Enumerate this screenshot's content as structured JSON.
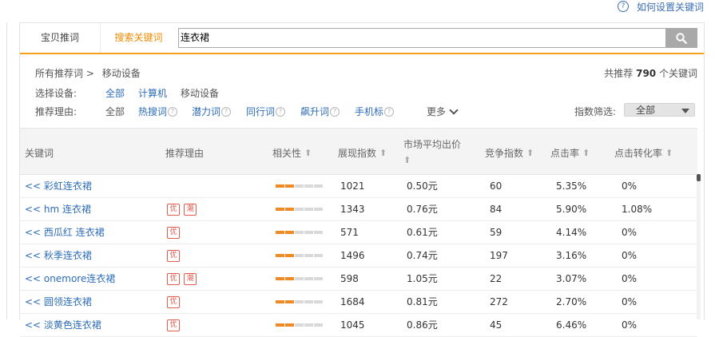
{
  "help": {
    "label": "如何设置关键词",
    "icon": "question-icon"
  },
  "tabs": {
    "item_tab": "宝贝推词",
    "keyword_tab": "搜索关键词"
  },
  "search": {
    "value": "连衣裙",
    "button_icon": "search-icon"
  },
  "breadcrumb": {
    "root": "所有推荐词 >",
    "current": "移动设备"
  },
  "total": {
    "prefix": "共推荐",
    "count": "790",
    "suffix": "个关键词"
  },
  "device": {
    "label": "选择设备:",
    "options": [
      "全部",
      "计算机",
      "移动设备"
    ]
  },
  "reasons": {
    "label": "推荐理由:",
    "items": [
      "全部",
      "热搜词",
      "潜力词",
      "同行词",
      "飙升词",
      "手机标"
    ],
    "more": "更多"
  },
  "index_filter": {
    "label": "指数筛选:",
    "value": "全部"
  },
  "table": {
    "headers": {
      "keyword": "关键词",
      "reason": "推荐理由",
      "relevance": "相关性",
      "display": "展现指数",
      "price": "市场平均出价",
      "competition": "竞争指数",
      "ctr": "点击率",
      "cvr": "点击转化率"
    },
    "sort_arrow": "⬆",
    "rows": [
      {
        "keyword": "<< 彩虹连衣裙",
        "tags": [],
        "relevance": 2,
        "display": "1021",
        "price": "0.50元",
        "competition": "60",
        "ctr": "5.35%",
        "cvr": "0%"
      },
      {
        "keyword": "<< hm 连衣裙",
        "tags": [
          "优",
          "潮"
        ],
        "relevance": 2,
        "display": "1343",
        "price": "0.76元",
        "competition": "84",
        "ctr": "5.90%",
        "cvr": "1.08%"
      },
      {
        "keyword": "<< 西瓜红 连衣裙",
        "tags": [
          "优"
        ],
        "relevance": 2,
        "display": "571",
        "price": "0.61元",
        "competition": "59",
        "ctr": "4.14%",
        "cvr": "0%"
      },
      {
        "keyword": "<< 秋季连衣裙",
        "tags": [
          "优"
        ],
        "relevance": 2,
        "display": "1496",
        "price": "0.74元",
        "competition": "197",
        "ctr": "3.16%",
        "cvr": "0%"
      },
      {
        "keyword": "<< onemore连衣裙",
        "tags": [
          "优",
          "潮"
        ],
        "relevance": 2,
        "display": "598",
        "price": "1.05元",
        "competition": "22",
        "ctr": "3.07%",
        "cvr": "0%"
      },
      {
        "keyword": "<< 圆领连衣裙",
        "tags": [
          "优"
        ],
        "relevance": 2,
        "display": "1684",
        "price": "0.81元",
        "competition": "272",
        "ctr": "2.70%",
        "cvr": "0%"
      },
      {
        "keyword": "<< 淡黄色连衣裙",
        "tags": [
          "优"
        ],
        "relevance": 2,
        "display": "1045",
        "price": "0.86元",
        "competition": "45",
        "ctr": "6.46%",
        "cvr": "0%"
      }
    ]
  }
}
